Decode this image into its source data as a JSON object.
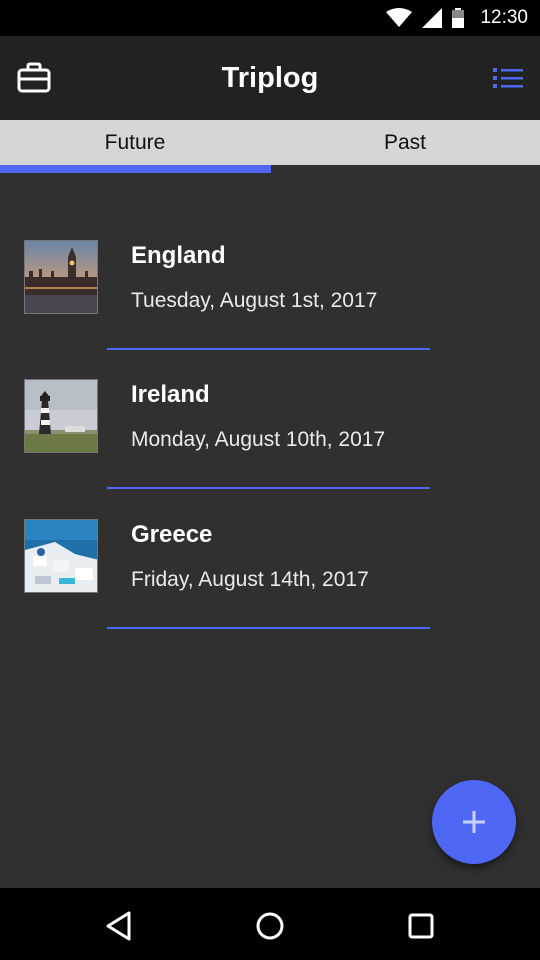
{
  "status_bar": {
    "time": "12:30",
    "icons": [
      "wifi-icon",
      "signal-icon",
      "battery-icon"
    ]
  },
  "app_bar": {
    "title": "Triplog",
    "left_icon": "briefcase-icon",
    "right_icon": "list-menu-icon"
  },
  "tabs": [
    {
      "label": "Future",
      "selected": true
    },
    {
      "label": "Past",
      "selected": false
    }
  ],
  "trips": [
    {
      "name": "England",
      "date": "Tuesday, August 1st, 2017",
      "thumbnail": "england-photo"
    },
    {
      "name": "Ireland",
      "date": "Monday, August 10th, 2017",
      "thumbnail": "ireland-photo"
    },
    {
      "name": "Greece",
      "date": "Friday, August 14th, 2017",
      "thumbnail": "greece-photo"
    }
  ],
  "fab": {
    "icon": "plus-icon"
  },
  "nav_bar": {
    "icons": [
      "back-icon",
      "home-icon",
      "recents-icon"
    ]
  },
  "colors": {
    "accent": "#4f67f5",
    "background": "#303030",
    "app_bar": "#222222",
    "tab_bar": "#d6d6d6"
  }
}
